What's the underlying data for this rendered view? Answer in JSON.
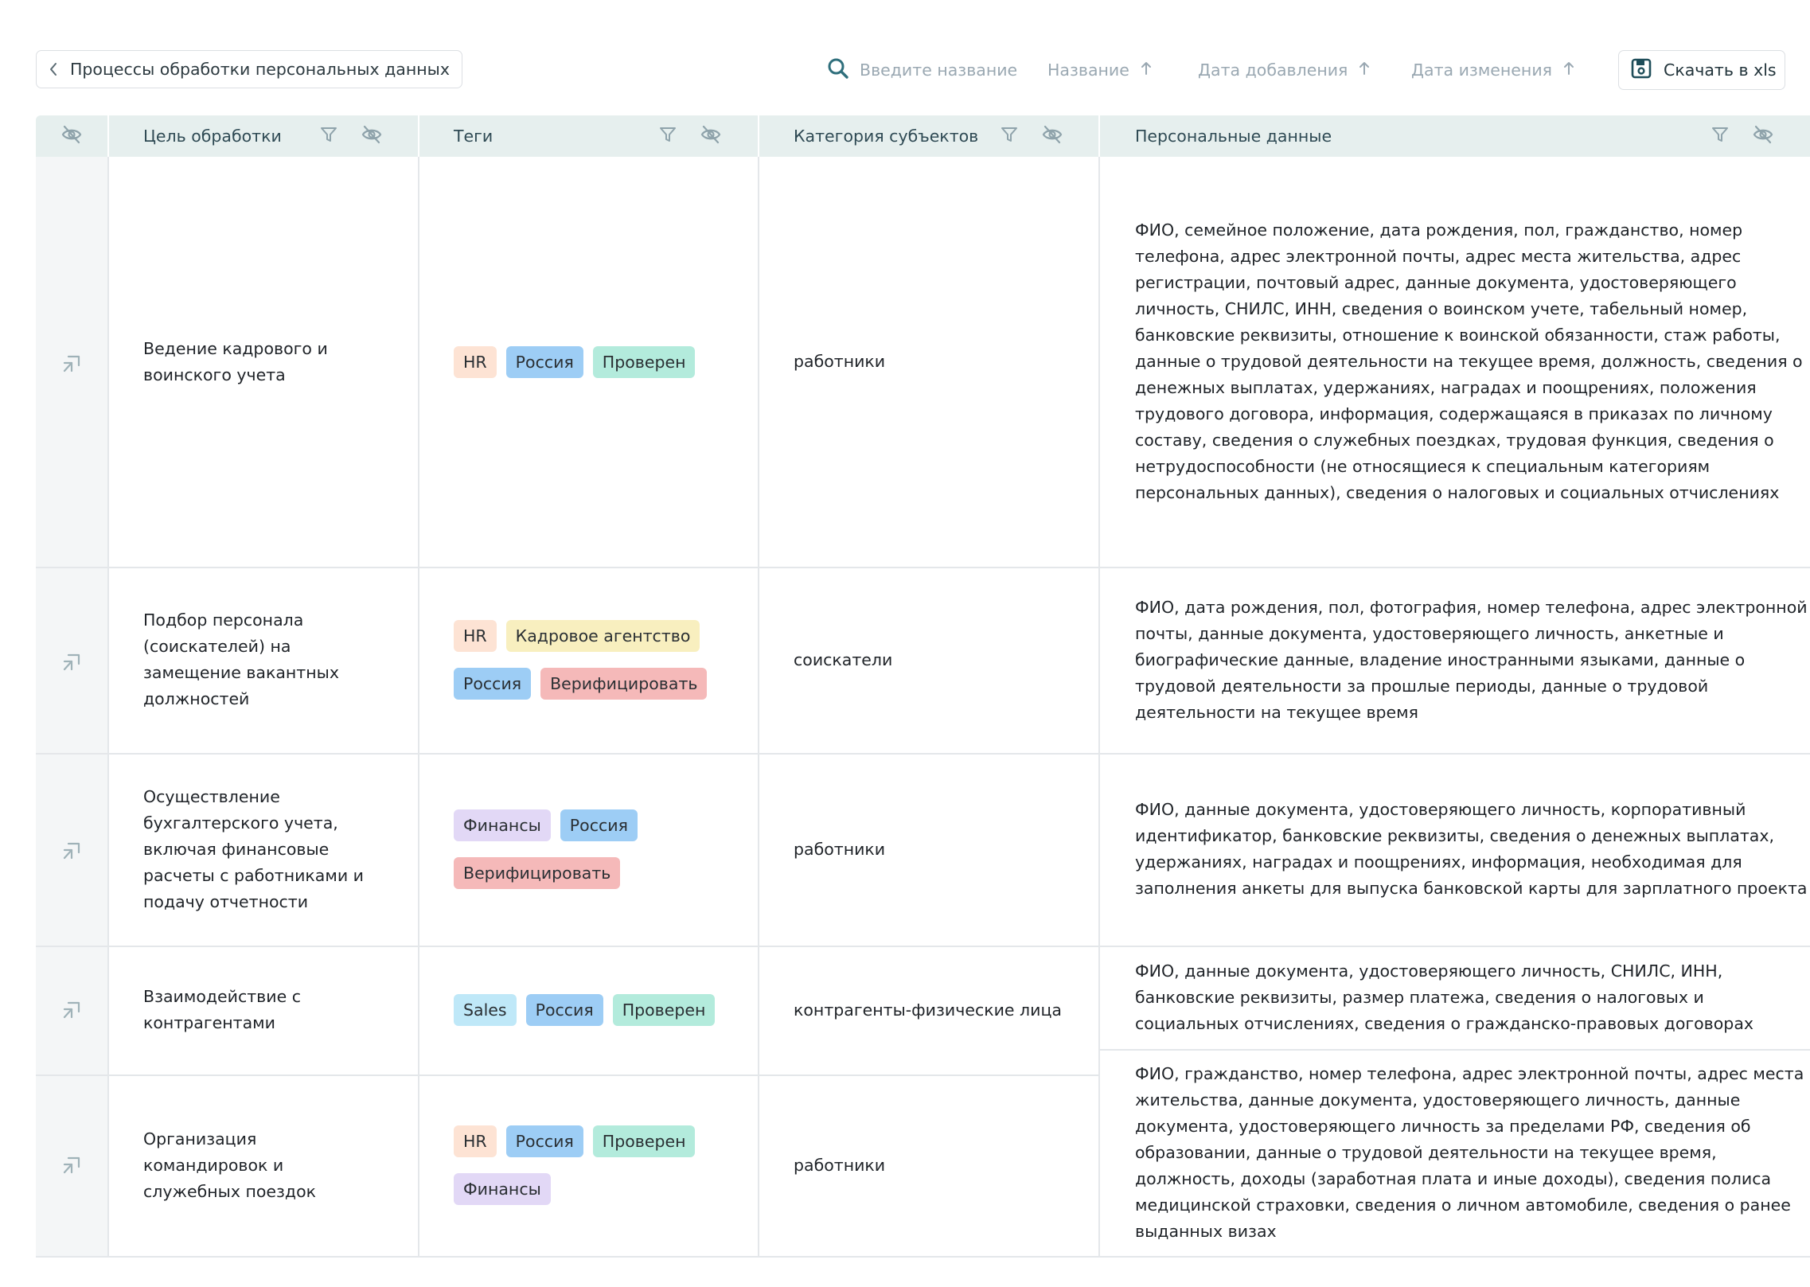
{
  "toolbar": {
    "back_label": "Процессы обработки персональных данных",
    "search_placeholder": "Введите название",
    "sort_name": "Название",
    "sort_added": "Дата добавления",
    "sort_changed": "Дата изменения",
    "download_label": "Скачать в xls"
  },
  "columns": {
    "purpose": "Цель обработки",
    "tags": "Теги",
    "subjects": "Категория субъектов",
    "personal_data": "Персональные данные"
  },
  "colors": {
    "header_bg": "#e6efee",
    "accent": "#2f6f7c",
    "tag_hr": "#fde3d4",
    "tag_russia": "#9dcdf5",
    "tag_checked": "#b3ebdc",
    "tag_agency": "#f8efbf",
    "tag_verify": "#f5b9b9",
    "tag_finance": "#e2d8f6",
    "tag_sales": "#bfe8f8"
  },
  "icons": {
    "back": "chevron-left-icon",
    "search": "search-icon",
    "sort": "arrow-up-icon",
    "download": "floppy-disk-icon",
    "filter": "filter-icon",
    "hide": "eye-off-icon",
    "row": "open-link-icon"
  },
  "rows": [
    {
      "purpose": "Ведение кадрового и воинского учета",
      "tags": [
        "HR",
        "Россия",
        "Проверен"
      ],
      "subjects": "работники",
      "personal_data": [
        "ФИО, семейное положение, дата рождения, пол, гражданство, номер телефона, адрес электронной почты, адрес места жительства, адрес регистрации, почтовый адрес, данные документа, удостоверяющего личность, СНИЛС, ИНН, сведения о воинском учете, табельный номер, банковские реквизиты, отношение к воинской обязанности, стаж работы, данные о трудовой деятельности на текущее время, должность, сведения о денежных выплатах, удержаниях, наградах и поощрениях, положения трудового договора, информация, содержащаяся в приказах по личному составу, сведения о служебных поездках, трудовая функция, сведения о нетрудоспособности (не относящиеся к специальным категориям персональных данных), сведения о налоговых и социальных отчислениях"
      ]
    },
    {
      "purpose": "Подбор персонала (соискателей) на замещение вакантных должностей",
      "tags": [
        "HR",
        "Кадровое агентство",
        "Россия",
        "Верифицировать"
      ],
      "subjects": "соискатели",
      "personal_data": [
        "ФИО, дата рождения, пол, фотография, номер телефона, адрес электронной почты, данные документа, удостоверяющего личность, анкетные и биографические данные, владение иностранными языками, данные о трудовой деятельности за прошлые периоды, данные о трудовой деятельности на текущее время"
      ]
    },
    {
      "purpose": "Осуществление бухгалтерского учета, включая финансовые расчеты с работниками и подачу отчетности",
      "tags": [
        "Финансы",
        "Россия",
        "Верифицировать"
      ],
      "subjects": "работники",
      "personal_data": [
        "ФИО, данные документа, удостоверяющего личность, корпоративный идентификатор, банковские реквизиты, сведения о денежных выплатах, удержаниях, наградах и поощрениях, информация, необходимая для заполнения анкеты для выпуска банковской карты для зарплатного проекта"
      ]
    },
    {
      "purpose": "Взаимодействие с контрагентами",
      "tags": [
        "Sales",
        "Россия",
        "Проверен"
      ],
      "subjects": "контрагенты-физические лица",
      "personal_data": [
        "ФИО, данные документа, удостоверяющего личность, СНИЛС, ИНН, банковские реквизиты, размер платежа, сведения о налоговых и социальных отчислениях, сведения о гражданско-правовых договорах"
      ]
    },
    {
      "purpose": "Организация командировок и служебных поездок",
      "tags": [
        "HR",
        "Россия",
        "Проверен",
        "Финансы"
      ],
      "subjects": "работники",
      "personal_data": [
        "ФИО, гражданство, номер телефона, адрес электронной почты, адрес места жительства, данные документа, удостоверяющего личность, данные документа, удостоверяющего личность за пределами РФ, сведения об образовании, данные о трудовой деятельности на текущее время, должность, доходы (заработная плата и иные доходы), сведения полиса медицинской страховки, сведения о личном автомобиле, сведения о ранее выданных визах"
      ]
    }
  ]
}
